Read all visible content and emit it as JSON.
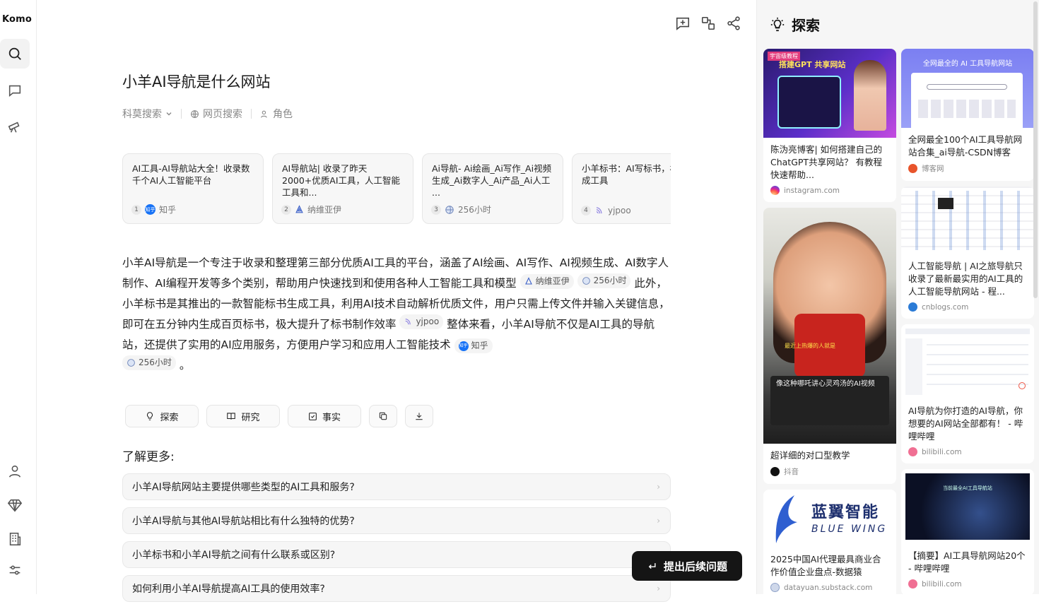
{
  "app": {
    "brand": "Komo"
  },
  "header": {
    "title": "小羊AI导航是什么网站"
  },
  "meta": {
    "search_mode": "科莫搜索",
    "web_search": "网页搜索",
    "role": "角色"
  },
  "source_cards": [
    {
      "num": "1",
      "title": "AI工具-AI导航站大全！收录数千个AI人工智能平台",
      "site": "知乎"
    },
    {
      "num": "2",
      "title": "AI导航站| 收录了昨天2000+优质AI工具，人工智能工具和...",
      "site": "纳维亚伊"
    },
    {
      "num": "3",
      "title": "Ai导航- Ai绘画_Ai写作_Ai视频生成_Ai数字人_Ai产品_Ai人工 ...",
      "site": "256小时"
    },
    {
      "num": "4",
      "title": "小羊标书：AI写标书，标书生成工具",
      "site": "yjpoo"
    }
  ],
  "answer": {
    "p1": "小羊AI导航是一个专注于收录和整理第三部分优质AI工具的平台，涵盖了AI绘画、AI写作、AI视频生成、AI数字人制作、AI编程开发等多个类别，帮助用户快速找到和使用各种人工智能工具和模型",
    "src1": "纳维亚伊",
    "src2": "256小时",
    "p2": "此外，小羊标书是其推出的一款智能标书生成工具，利用AI技术自动解析优质文件，用户只需上传文件并输入关键信息，即可在五分钟内生成百页标书，极大提升了标书制作效率",
    "src3": "yjpoo",
    "p3": "整体来看，小羊AI导航不仅是AI工具的导航站，还提供了实用的AI应用服务，方便用户学习和应用人工智能技术",
    "src4": "知乎",
    "src5": "256小时",
    "end": "。"
  },
  "actions": {
    "explore": "探索",
    "research": "研究",
    "facts": "事实"
  },
  "learn_more": {
    "heading": "了解更多:",
    "questions": [
      "小羊AI导航网站主要提供哪些类型的AI工具和服务?",
      "小羊AI导航与其他AI导航站相比有什么独特的优势?",
      "小羊标书和小羊AI导航之间有什么联系或区别?",
      "如何利用小羊AI导航提高AI工具的使用效率?"
    ]
  },
  "followup": {
    "label": "提出后续问题"
  },
  "explore_panel": {
    "title": "探索",
    "left": [
      {
        "overlay1": "宇宙级教程",
        "overlay2": "搭建GPT 共享网站",
        "caption": "陈沩亮博客| 如何搭建自己的ChatGPT共享网站？ 有教程 快速帮助...",
        "site": "instagram.com",
        "color": "#e1306c"
      },
      {
        "overlay1": "像这种哪吒讲心灵鸡汤的AI视频",
        "overlay2": "最近上热爆的人就是",
        "caption": "超详细的对口型教学",
        "site": "抖音",
        "color": "#111111"
      },
      {
        "overlay1": "蓝翼智能",
        "overlay2": "BLUE WING",
        "caption": "2025中国AI代理最具商业合作价值企业盘点-数据猿",
        "site": "datayuan.substack.com",
        "color": "#3a6fd8"
      }
    ],
    "right": [
      {
        "overlay1": "全网最全的 AI 工具导航网站",
        "caption": "全网最全100个AI工具导航网站合集_ai导航-CSDN博客",
        "site": "博客网",
        "color": "#e8542b"
      },
      {
        "caption": "人工智能导航 | AI之旅导航只收录了最新最实用的AI工具的人工智能导航网站 - 程...",
        "site": "cnblogs.com",
        "color": "#2b7bd6"
      },
      {
        "caption": "AI导航为你打造的AI导航，你想要的AI网站全部都有！ - 哔哩哔哩",
        "site": "bilibili.com",
        "color": "#f06f93"
      },
      {
        "overlay1": "当前最全AI工具导航站",
        "caption": "【摘要】AI工具导航网站20个 - 哔哩哔哩",
        "site": "bilibili.com",
        "color": "#f06f93"
      }
    ]
  }
}
